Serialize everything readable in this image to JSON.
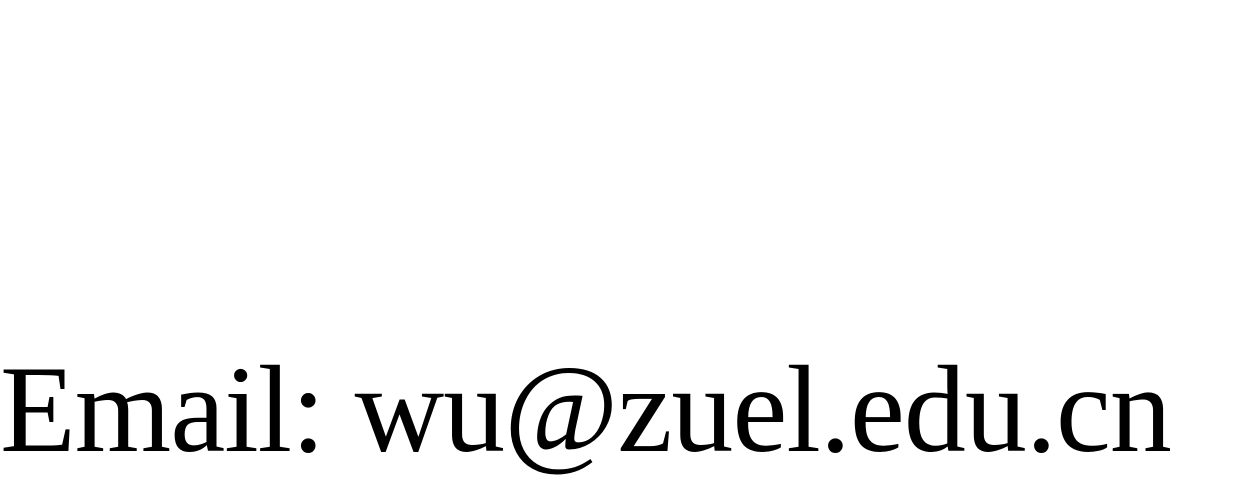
{
  "contact": {
    "email_text": "Email: wu@zuel.edu.cn"
  },
  "colors": {
    "background": "#ffffff",
    "text": "#000000"
  }
}
